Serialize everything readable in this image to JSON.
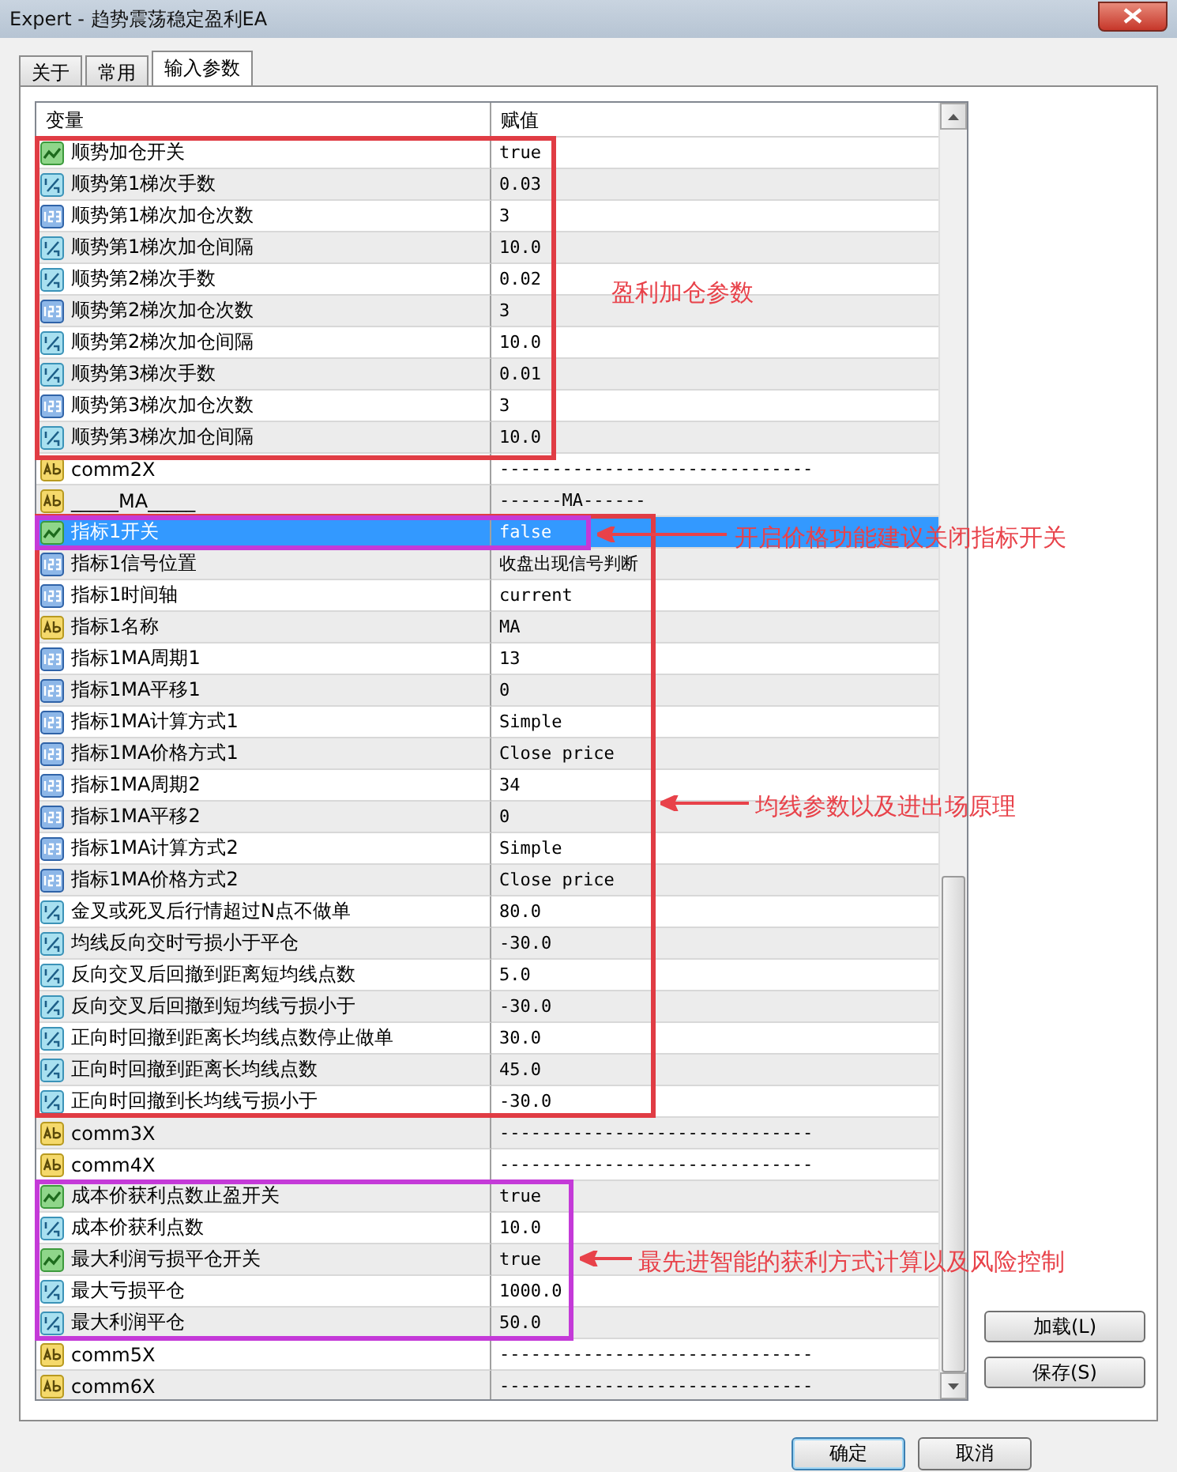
{
  "window": {
    "title": "Expert - 趋势震荡稳定盈利EA"
  },
  "tabs": [
    {
      "label": "关于",
      "selected": false
    },
    {
      "label": "常用",
      "selected": false
    },
    {
      "label": "输入参数",
      "selected": true
    }
  ],
  "table": {
    "columns": [
      "变量",
      "赋值"
    ],
    "rows": [
      {
        "kind": "bool",
        "name": "顺势加仓开关",
        "value": "true",
        "selected": false
      },
      {
        "kind": "double",
        "name": "顺势第1梯次手数",
        "value": "0.03",
        "selected": false
      },
      {
        "kind": "int",
        "name": "顺势第1梯次加仓次数",
        "value": "3",
        "selected": false
      },
      {
        "kind": "double",
        "name": "顺势第1梯次加仓间隔",
        "value": "10.0",
        "selected": false
      },
      {
        "kind": "double",
        "name": "顺势第2梯次手数",
        "value": "0.02",
        "selected": false
      },
      {
        "kind": "int",
        "name": "顺势第2梯次加仓次数",
        "value": "3",
        "selected": false
      },
      {
        "kind": "double",
        "name": "顺势第2梯次加仓间隔",
        "value": "10.0",
        "selected": false
      },
      {
        "kind": "double",
        "name": "顺势第3梯次手数",
        "value": "0.01",
        "selected": false
      },
      {
        "kind": "int",
        "name": "顺势第3梯次加仓次数",
        "value": "3",
        "selected": false
      },
      {
        "kind": "double",
        "name": "顺势第3梯次加仓间隔",
        "value": "10.0",
        "selected": false
      },
      {
        "kind": "string",
        "name": "comm2X",
        "value": "------------------------------",
        "selected": false
      },
      {
        "kind": "string",
        "name": "_____MA_____",
        "value": "------MA------",
        "selected": false
      },
      {
        "kind": "bool",
        "name": "指标1开关",
        "value": "false",
        "selected": true
      },
      {
        "kind": "int",
        "name": "指标1信号位置",
        "value": "收盘出现信号判断",
        "selected": false
      },
      {
        "kind": "int",
        "name": "指标1时间轴",
        "value": "current",
        "selected": false
      },
      {
        "kind": "string",
        "name": "指标1名称",
        "value": "MA",
        "selected": false
      },
      {
        "kind": "int",
        "name": "指标1MA周期1",
        "value": "13",
        "selected": false
      },
      {
        "kind": "int",
        "name": "指标1MA平移1",
        "value": "0",
        "selected": false
      },
      {
        "kind": "int",
        "name": "指标1MA计算方式1",
        "value": "Simple",
        "selected": false
      },
      {
        "kind": "int",
        "name": "指标1MA价格方式1",
        "value": "Close price",
        "selected": false
      },
      {
        "kind": "int",
        "name": "指标1MA周期2",
        "value": "34",
        "selected": false
      },
      {
        "kind": "int",
        "name": "指标1MA平移2",
        "value": "0",
        "selected": false
      },
      {
        "kind": "int",
        "name": "指标1MA计算方式2",
        "value": "Simple",
        "selected": false
      },
      {
        "kind": "int",
        "name": "指标1MA价格方式2",
        "value": "Close price",
        "selected": false
      },
      {
        "kind": "double",
        "name": "金叉或死叉后行情超过N点不做单",
        "value": "80.0",
        "selected": false
      },
      {
        "kind": "double",
        "name": "均线反向交时亏损小于平仓",
        "value": "-30.0",
        "selected": false
      },
      {
        "kind": "double",
        "name": "反向交叉后回撤到距离短均线点数",
        "value": "5.0",
        "selected": false
      },
      {
        "kind": "double",
        "name": "反向交叉后回撤到短均线亏损小于",
        "value": "-30.0",
        "selected": false
      },
      {
        "kind": "double",
        "name": "正向时回撤到距离长均线点数停止做单",
        "value": "30.0",
        "selected": false
      },
      {
        "kind": "double",
        "name": "正向时回撤到距离长均线点数",
        "value": "45.0",
        "selected": false
      },
      {
        "kind": "double",
        "name": "正向时回撤到长均线亏损小于",
        "value": "-30.0",
        "selected": false
      },
      {
        "kind": "string",
        "name": "comm3X",
        "value": "------------------------------",
        "selected": false
      },
      {
        "kind": "string",
        "name": "comm4X",
        "value": "------------------------------",
        "selected": false
      },
      {
        "kind": "bool",
        "name": "成本价获利点数止盈开关",
        "value": "true",
        "selected": false
      },
      {
        "kind": "double",
        "name": "成本价获利点数",
        "value": "10.0",
        "selected": false
      },
      {
        "kind": "bool",
        "name": "最大利润亏损平仓开关",
        "value": "true",
        "selected": false
      },
      {
        "kind": "double",
        "name": "最大亏损平仓",
        "value": "1000.0",
        "selected": false
      },
      {
        "kind": "double",
        "name": "最大利润平仓",
        "value": "50.0",
        "selected": false
      },
      {
        "kind": "string",
        "name": "comm5X",
        "value": "------------------------------",
        "selected": false
      },
      {
        "kind": "string",
        "name": "comm6X",
        "value": "------------------------------",
        "selected": false
      }
    ]
  },
  "side_buttons": [
    "加载(L)",
    "保存(S)"
  ],
  "buttons": [
    "确定",
    "取消"
  ],
  "annotations": [
    "盈利加仓参数",
    "开启价格功能建议关闭指标开关",
    "均线参数以及进出场原理",
    "最先进智能的获利方式计算以及风险控制"
  ]
}
